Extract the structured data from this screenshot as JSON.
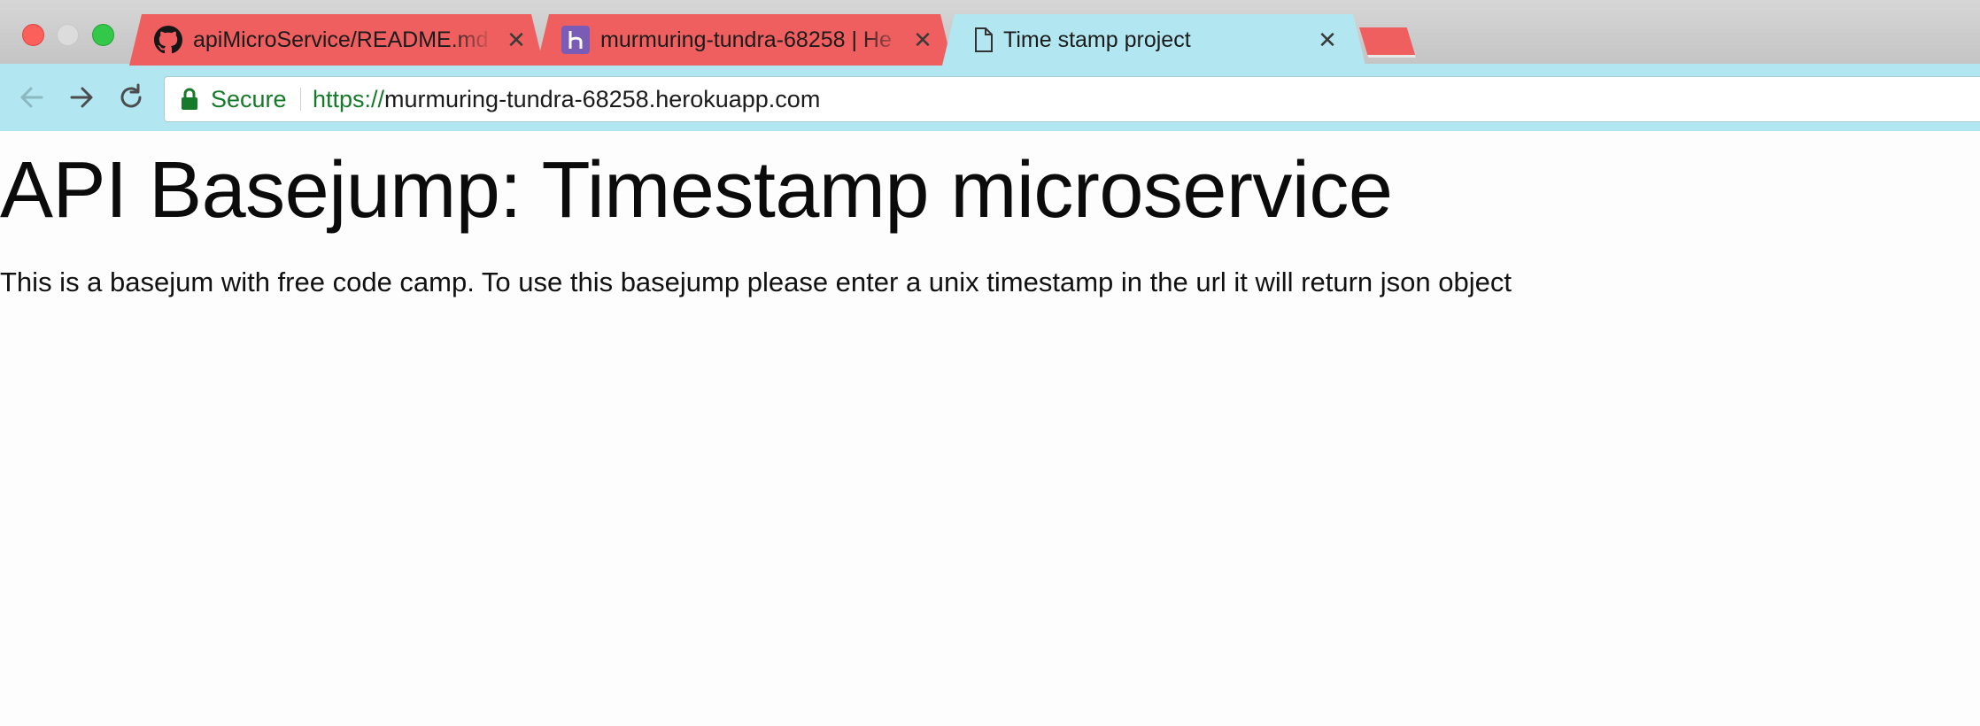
{
  "browser": {
    "tabs": [
      {
        "title": "apiMicroService/README.md a",
        "favicon": "github-icon",
        "active": false
      },
      {
        "title": "murmuring-tundra-68258 | He",
        "favicon": "heroku-icon",
        "active": false
      },
      {
        "title": "Time stamp project",
        "favicon": "document-icon",
        "active": true
      }
    ],
    "address_bar": {
      "security_label": "Secure",
      "url_scheme": "https://",
      "url_host": "murmuring-tundra-68258.herokuapp.com"
    }
  },
  "page": {
    "title": "API Basejump: Timestamp microservice",
    "description": "This is a basejum with free code camp. To use this basejump please enter a unix timestamp in the url it will return json object"
  },
  "colors": {
    "inactive_tab": "#f05f5f",
    "active_tab": "#b2e7f1",
    "secure_green": "#167a2b"
  }
}
